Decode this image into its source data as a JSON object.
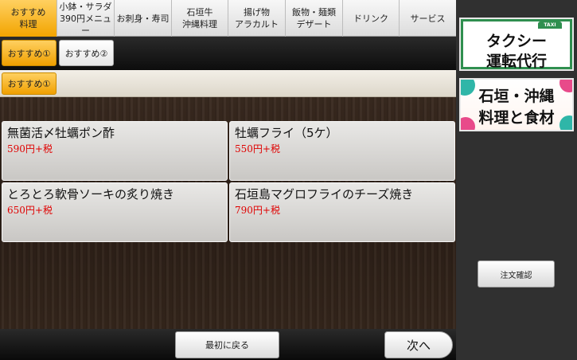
{
  "top_nav": {
    "tabs": [
      {
        "label": "おすすめ\n料理",
        "active": true
      },
      {
        "label": "小鉢・サラダ\n390円メニュー",
        "active": false
      },
      {
        "label": "お刺身・寿司",
        "active": false
      },
      {
        "label": "石垣牛\n沖縄料理",
        "active": false
      },
      {
        "label": "揚げ物\nアラカルト",
        "active": false
      },
      {
        "label": "飯物・麺類\nデザート",
        "active": false
      },
      {
        "label": "ドリンク",
        "active": false
      },
      {
        "label": "サービス",
        "active": false
      }
    ]
  },
  "sub_tabs": [
    {
      "label": "おすすめ①",
      "active": true
    },
    {
      "label": "おすすめ②",
      "active": false
    }
  ],
  "section": {
    "title": "おすすめ①"
  },
  "menu_items": [
    {
      "name": "無菌活〆牡蠣ポン酢",
      "price": "590円+税"
    },
    {
      "name": "牡蠣フライ（5ケ）",
      "price": "550円+税"
    },
    {
      "name": "とろとろ軟骨ソーキの炙り焼き",
      "price": "650円+税"
    },
    {
      "name": "石垣島マグロフライのチーズ焼き",
      "price": "790円+税"
    }
  ],
  "bottom": {
    "back_to_top": "最初に戻る",
    "next": "次へ"
  },
  "right_panel": {
    "taxi_banner": {
      "sign": "TAXI",
      "line1": "タクシー",
      "line2": "運転代行"
    },
    "okinawa_banner": {
      "line1": "石垣・沖縄",
      "line2": "料理と食材"
    },
    "order_confirm": "注文確認"
  },
  "colors": {
    "accent_orange": "#f2a400",
    "price_red": "#e00000",
    "taxi_green": "#2f8f4f"
  }
}
